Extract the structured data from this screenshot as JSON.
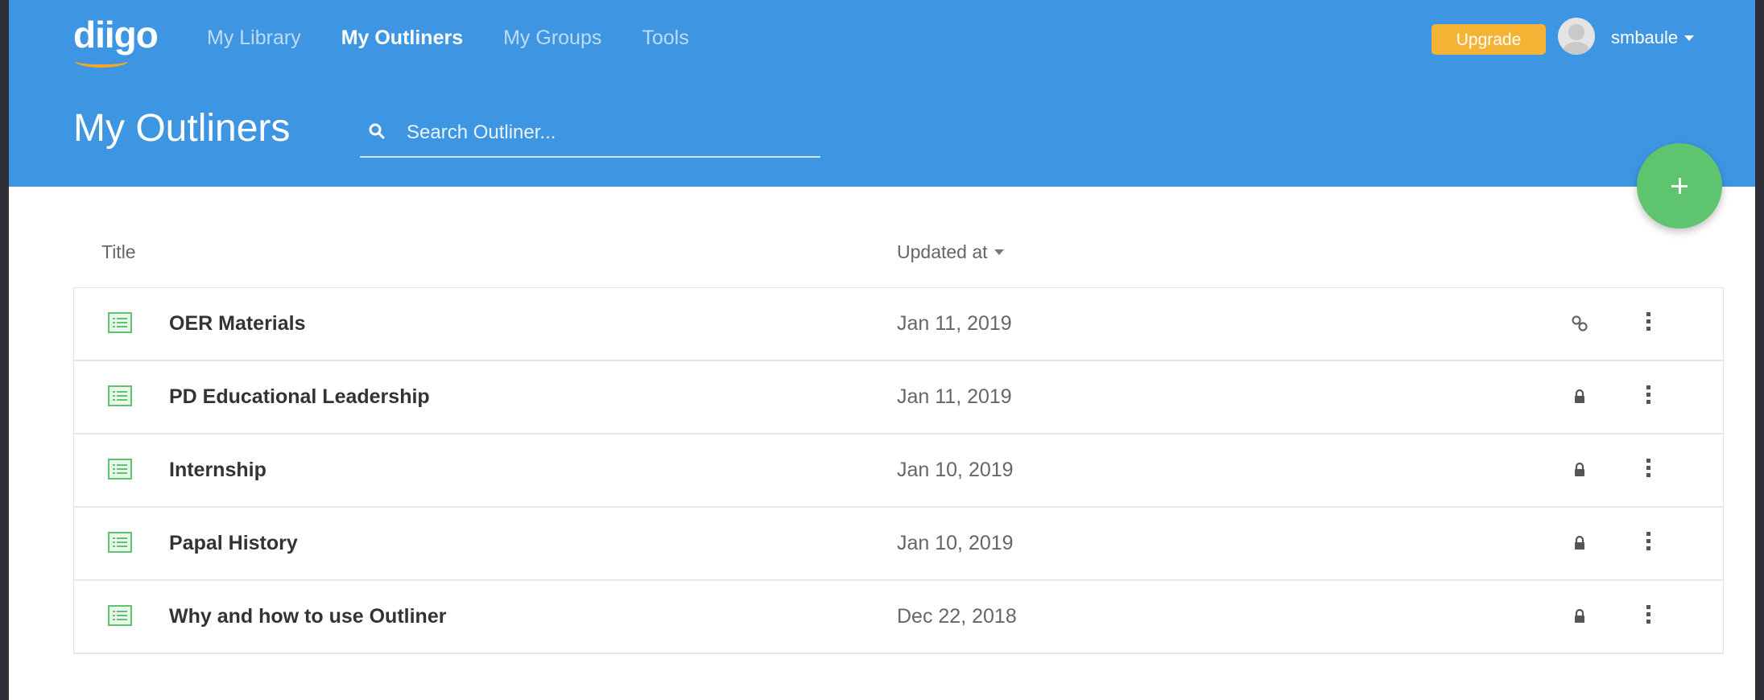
{
  "brand": {
    "logo_text": "diigo"
  },
  "nav": {
    "items": [
      {
        "label": "My Library",
        "active": false
      },
      {
        "label": "My Outliners",
        "active": true
      },
      {
        "label": "My Groups",
        "active": false
      },
      {
        "label": "Tools",
        "active": false
      }
    ]
  },
  "account": {
    "upgrade_label": "Upgrade",
    "username": "smbaule"
  },
  "page": {
    "title": "My Outliners"
  },
  "search": {
    "placeholder": "Search Outliner...",
    "value": ""
  },
  "add_button": {
    "icon": "plus-icon"
  },
  "table": {
    "columns": {
      "title": "Title",
      "updated": "Updated at"
    },
    "rows": [
      {
        "title": "OER Materials",
        "updated": "Jan 11, 2019",
        "status_icon": "link-icon"
      },
      {
        "title": "PD Educational Leadership",
        "updated": "Jan 11, 2019",
        "status_icon": "lock-icon"
      },
      {
        "title": "Internship",
        "updated": "Jan 10, 2019",
        "status_icon": "lock-icon"
      },
      {
        "title": "Papal History",
        "updated": "Jan 10, 2019",
        "status_icon": "lock-icon"
      },
      {
        "title": "Why and how to use Outliner",
        "updated": "Dec 22, 2018",
        "status_icon": "lock-icon"
      }
    ]
  },
  "colors": {
    "header_bg": "#3e96e3",
    "upgrade_bg": "#f5b335",
    "fab_bg": "#5ec46f",
    "outline_icon": "#5ec46f",
    "logo_smile": "#f5a623"
  }
}
